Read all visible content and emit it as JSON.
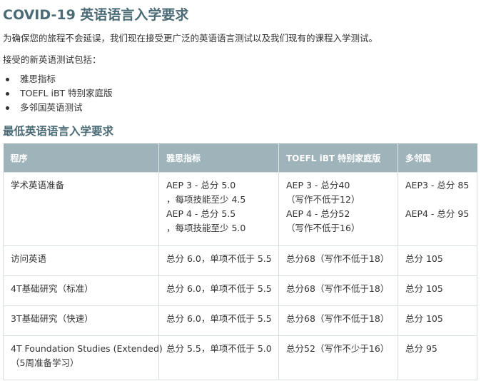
{
  "title": "COVID-19 英语语言入学要求",
  "intro": "为确保您的旅程不会延误，我们现在接受更广泛的英语语言测试以及我们现有的课程入学测试。",
  "accepted_label": "接受的新英语测试包括：",
  "tests": [
    "雅思指标",
    "TOEFL iBT 特别家庭版",
    "多邻国英语测试"
  ],
  "subtitle": "最低英语语言入学要求",
  "table": {
    "headers": [
      "程序",
      "雅思指标",
      "TOEFL iBT 特别家庭版",
      "多邻国"
    ],
    "rows": [
      {
        "program": [
          "学术英语准备"
        ],
        "ielts": [
          "AEP 3 - 总分 5.0",
          "，每项技能至少 4.5",
          "AEP 4 - 总分 5.5",
          "，每项技能至少 5.0"
        ],
        "toefl": [
          "AEP 3 - 总分40",
          "（写作不低于12）",
          "AEP 4 - 总分52",
          "（写作不低于16）"
        ],
        "duolingo": [
          "AEP3 - 总分 85",
          "AEP4 - 总分 95"
        ]
      },
      {
        "program": [
          "访问英语"
        ],
        "ielts": [
          "总分 6.0，单项不低于 5.5"
        ],
        "toefl": [
          "总分68（写作不低于18）"
        ],
        "duolingo": [
          "总分 105"
        ]
      },
      {
        "program": [
          "4T基础研究（标准）"
        ],
        "ielts": [
          "总分 6.0，单项不低于 5.5"
        ],
        "toefl": [
          "总分68（写作不低于18）"
        ],
        "duolingo": [
          "总分 105"
        ]
      },
      {
        "program": [
          "3T基础研究（快速）"
        ],
        "ielts": [
          "总分 6.0，单项不低于 5.5"
        ],
        "toefl": [
          "总分68（写作不低于18）"
        ],
        "duolingo": [
          "总分 105"
        ]
      },
      {
        "program": [
          "4T Foundation Studies (Extended)",
          "（5周准备学习）"
        ],
        "ielts": [
          "总分 5.5，单项不低于 5.0"
        ],
        "toefl": [
          "总分52（写作不少于16）"
        ],
        "duolingo": [
          "总分 95"
        ]
      }
    ]
  }
}
